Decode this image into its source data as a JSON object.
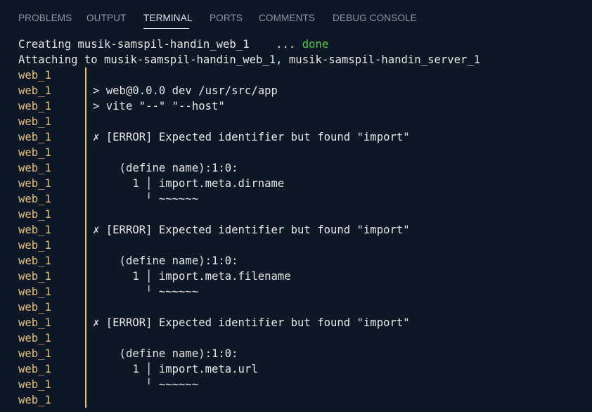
{
  "tabs": [
    {
      "label": "PROBLEMS"
    },
    {
      "label": "OUTPUT"
    },
    {
      "label": "TERMINAL"
    },
    {
      "label": "PORTS"
    },
    {
      "label": "COMMENTS"
    },
    {
      "label": "DEBUG CONSOLE"
    }
  ],
  "active_tab": "TERMINAL",
  "colors": {
    "background": "#0e1726",
    "service_prefix": "#e5c07b",
    "done": "#4ec94e",
    "text": "#e6e6e6",
    "tab_inactive": "#8c95a3",
    "tab_active": "#dfe4ea"
  },
  "terminal": {
    "creating_prefix": "Creating musik-samspil-handin_web_1    ... ",
    "creating_status": "done",
    "attaching": "Attaching to musik-samspil-handin_web_1, musik-samspil-handin_server_1",
    "service": "web_1",
    "log_lines": [
      "",
      "> web@0.0.0 dev /usr/src/app",
      "> vite \"--\" \"--host\"",
      "",
      "✗ [ERROR] Expected identifier but found \"import\"",
      "",
      "    (define name):1:0:",
      "      1 │ import.meta.dirname",
      "        ╵ ~~~~~~",
      "",
      "✗ [ERROR] Expected identifier but found \"import\"",
      "",
      "    (define name):1:0:",
      "      1 │ import.meta.filename",
      "        ╵ ~~~~~~",
      "",
      "✗ [ERROR] Expected identifier but found \"import\"",
      "",
      "    (define name):1:0:",
      "      1 │ import.meta.url",
      "        ╵ ~~~~~~",
      ""
    ]
  }
}
